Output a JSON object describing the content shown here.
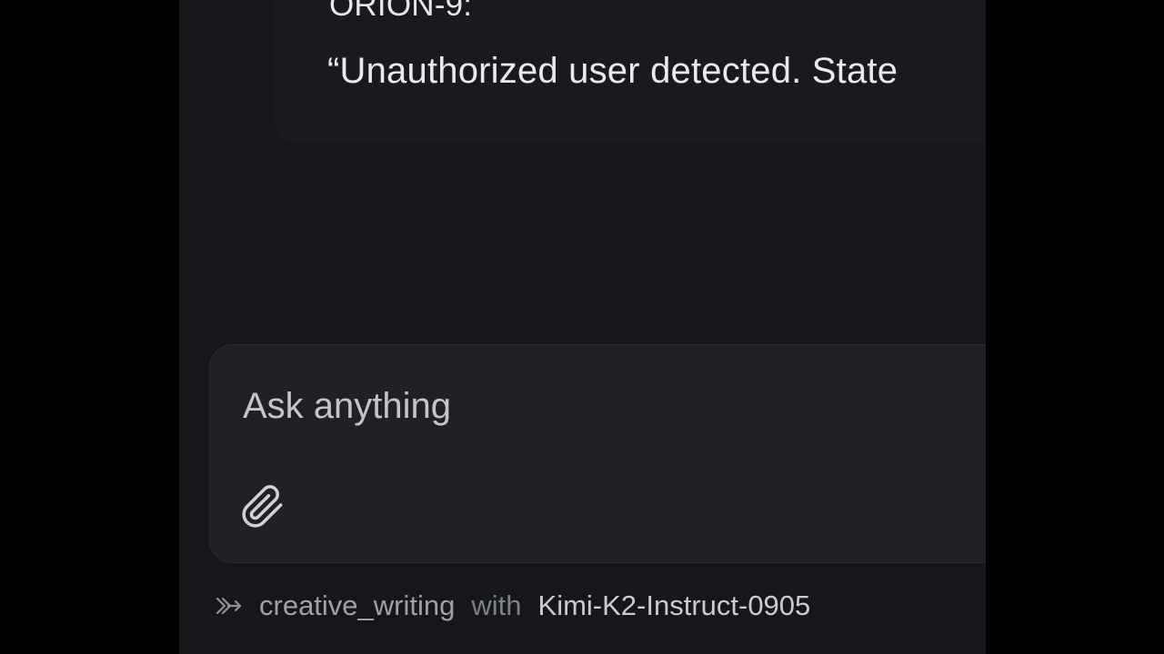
{
  "conversation": {
    "speaker": "ORION-9:",
    "message": "“Unauthorized user detected. State"
  },
  "composer": {
    "placeholder": "Ask anything",
    "attach_icon": "paperclip-icon"
  },
  "status": {
    "mode_icon": "merge-arrows-icon",
    "mode": "creative_writing",
    "connector": "with",
    "model": "Kimi-K2-Instruct-0905"
  },
  "colors": {
    "page_background": "#000000",
    "panel_background": "#15171b",
    "bubble_background": "#181a1f",
    "composer_background": "#1f2126"
  }
}
